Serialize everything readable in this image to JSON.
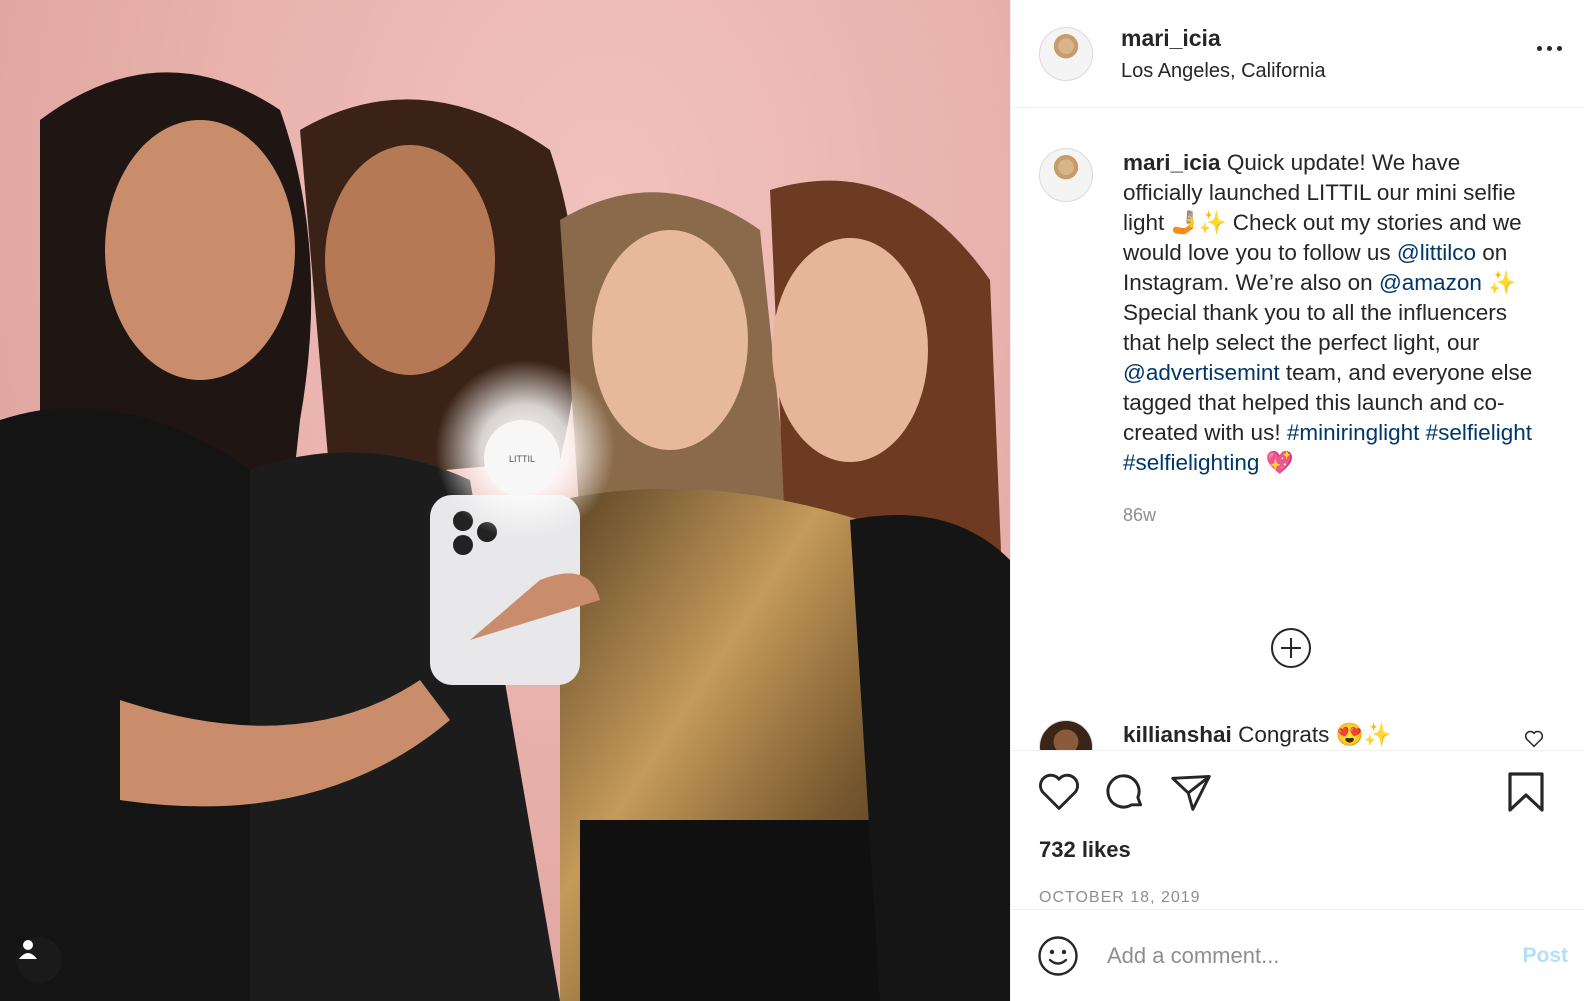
{
  "photo": {
    "brand_text": "LITTIL",
    "tag_icon": "user-icon"
  },
  "header": {
    "username": "mari_icia",
    "location": "Los Angeles, California",
    "more_icon": "more-horizontal-icon"
  },
  "caption": {
    "username": "mari_icia",
    "seg1": " Quick update! We have officially launched LITTIL our mini selfie light 🤳✨ Check out my stories and we would love you to follow us ",
    "link1": "@littilco",
    "seg2": " on Instagram. We’re also on ",
    "link2": "@amazon",
    "seg3": " ✨ Special thank you to all the influencers that help select the perfect light, our ",
    "link3": "@advertisemint",
    "seg4": " team, and everyone else tagged that helped this launch and co-created with us! ",
    "tag1": "#miniringlight",
    "tag2": "#selfielight",
    "tag3": "#selfielighting",
    "seg5": " 💖",
    "time": "86w"
  },
  "comment": {
    "username": "killianshai",
    "text": " Congrats 😍✨"
  },
  "actions": {
    "like_icon": "heart-icon",
    "comment_icon": "comment-icon",
    "share_icon": "send-icon",
    "save_icon": "bookmark-icon"
  },
  "likes": "732 likes",
  "date": "OCTOBER 18, 2019",
  "add_comment": {
    "placeholder": "Add a comment...",
    "post_label": "Post"
  },
  "colors": {
    "background": "#e9b2ad",
    "link": "#00376b",
    "post_button": "#b2dffc",
    "muted": "#8e8e8e"
  }
}
